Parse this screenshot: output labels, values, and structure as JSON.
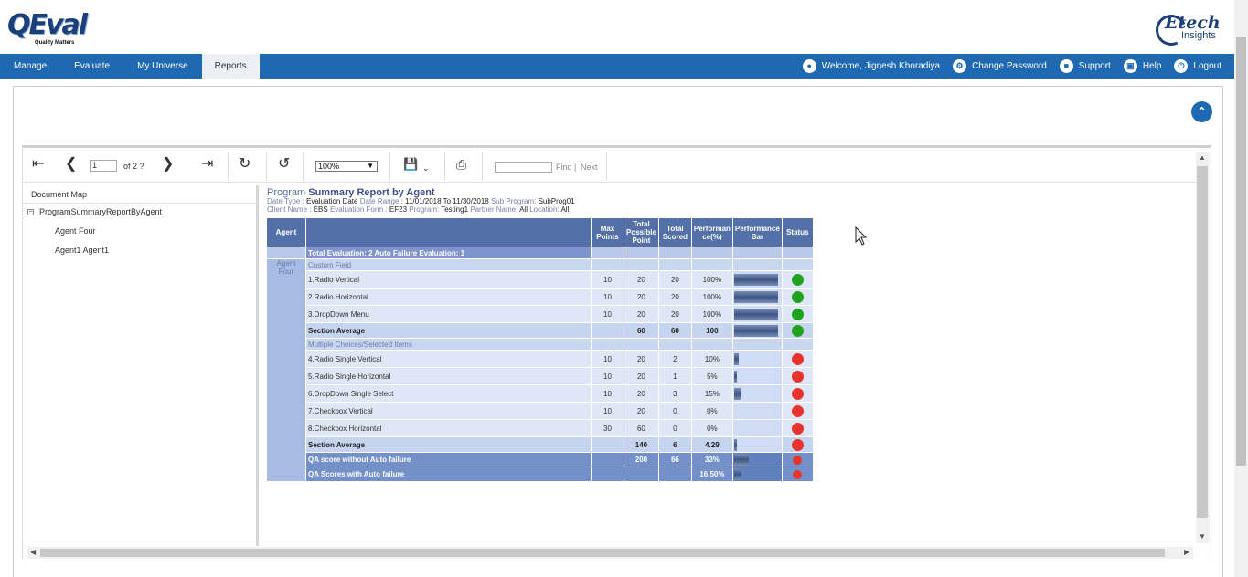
{
  "brand": {
    "left_logo": "QEval",
    "left_tagline": "Quality Matters",
    "right_logo_top": "Etech",
    "right_logo_bottom": "Insights"
  },
  "nav": {
    "items": [
      "Manage",
      "Evaluate",
      "My Universe",
      "Reports"
    ],
    "active": "Reports",
    "right": [
      {
        "label": "Welcome, Jignesh Khoradiya",
        "icon": "user-icon"
      },
      {
        "label": "Change Password",
        "icon": "gear-icon"
      },
      {
        "label": "Support",
        "icon": "support-icon"
      },
      {
        "label": "Help",
        "icon": "help-icon"
      },
      {
        "label": "Logout",
        "icon": "power-icon"
      }
    ]
  },
  "toolbar": {
    "page_value": "1",
    "page_of": "of 2 ?",
    "zoom": "100%",
    "find_label": "Find",
    "find_sep": "|",
    "next_label": "Next"
  },
  "docmap": {
    "title": "Document Map",
    "root": "ProgramSummaryReportByAgent",
    "children": [
      "Agent Four",
      "Agent1 Agent1"
    ]
  },
  "report": {
    "title_prefix": "Program",
    "title_main": "Summary Report by Agent",
    "line1": {
      "date_type_label": "Date Type :",
      "date_type": "Evaluation Date",
      "date_range_label": "Date Range :",
      "date_range": "11/01/2018  To  11/30/2018",
      "sub_program_label": "Sub Program:",
      "sub_program": "SubProg01"
    },
    "line2": {
      "client_label": "Client Name :",
      "client": "EBS",
      "form_label": "Evaluation Form :",
      "form": "EF23",
      "program_label": "Program:",
      "program": "Testing1",
      "partner_label": "Partner Name:",
      "partner": "All",
      "location_label": "Location:",
      "location": "All"
    },
    "headers": {
      "agent": "Agent",
      "max_points": "Max Points",
      "total_possible": "Total Possible Point",
      "total_scored": "Total Scored",
      "performance": "Performan ce(%)",
      "performance_bar": "Performance Bar",
      "status": "Status"
    },
    "total_line": "Total Evaluation: 2 Auto Failure Evaluation: 1",
    "agent_name": "Agent Four",
    "sections": [
      {
        "name": "Custom Field",
        "items": [
          {
            "label": "1.Radio Vertical",
            "max": "10",
            "possible": "20",
            "scored": "20",
            "perf": "100%",
            "bar": 1.0,
            "status": "green"
          },
          {
            "label": "2.Radio Horizontal",
            "max": "10",
            "possible": "20",
            "scored": "20",
            "perf": "100%",
            "bar": 1.0,
            "status": "green"
          },
          {
            "label": "3.DropDown Menu",
            "max": "10",
            "possible": "20",
            "scored": "20",
            "perf": "100%",
            "bar": 1.0,
            "status": "green"
          }
        ],
        "avg": {
          "label": "Section Average",
          "possible": "60",
          "scored": "60",
          "perf": "100",
          "bar": 1.0,
          "status": "green"
        }
      },
      {
        "name": "Multiple Choices/Selected Items",
        "items": [
          {
            "label": "4.Radio Single Vertical",
            "max": "10",
            "possible": "20",
            "scored": "2",
            "perf": "10%",
            "bar": 0.1,
            "status": "red"
          },
          {
            "label": "5.Radio Single Horizontal",
            "max": "10",
            "possible": "20",
            "scored": "1",
            "perf": "5%",
            "bar": 0.05,
            "status": "red"
          },
          {
            "label": "6.DropDown Single Select",
            "max": "10",
            "possible": "20",
            "scored": "3",
            "perf": "15%",
            "bar": 0.15,
            "status": "red"
          },
          {
            "label": "7.Checkbox Vertical",
            "max": "10",
            "possible": "20",
            "scored": "0",
            "perf": "0%",
            "bar": 0,
            "status": "red"
          },
          {
            "label": "8.Checkbox Horizontal",
            "max": "30",
            "possible": "60",
            "scored": "0",
            "perf": "0%",
            "bar": 0,
            "status": "red"
          }
        ],
        "avg": {
          "label": "Section Average",
          "possible": "140",
          "scored": "6",
          "perf": "4.29",
          "bar": 0.0429,
          "status": "red"
        }
      }
    ],
    "qa_rows": [
      {
        "label": "QA score without Auto failure",
        "possible": "200",
        "scored": "66",
        "perf": "33%",
        "bar": 0.33,
        "status": "red"
      },
      {
        "label": "QA Scores with Auto failure",
        "possible": "",
        "scored": "",
        "perf": "16.50%",
        "bar": 0.165,
        "status": "red"
      }
    ]
  }
}
